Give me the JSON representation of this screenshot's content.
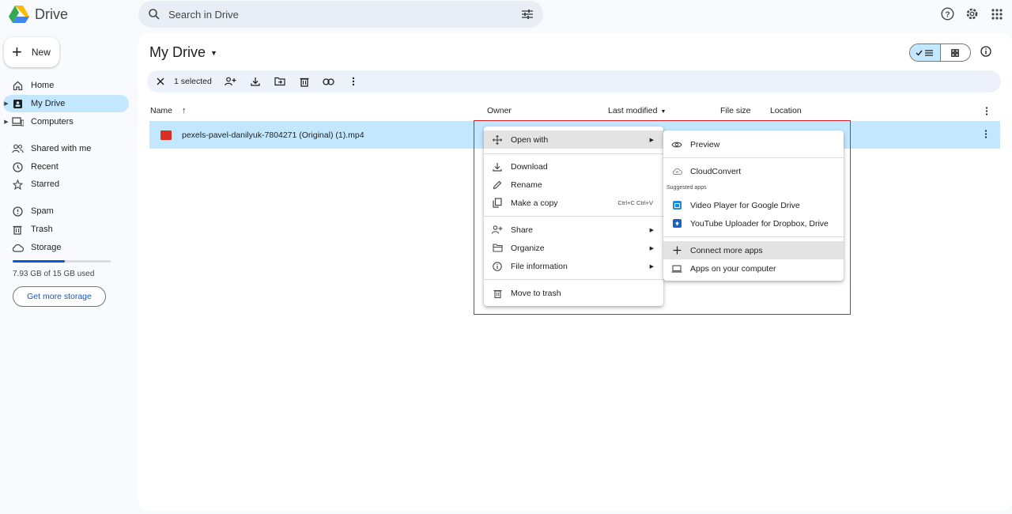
{
  "app": {
    "name": "Drive"
  },
  "search": {
    "placeholder": "Search in Drive"
  },
  "new_button": {
    "label": "New"
  },
  "sidebar": {
    "items": [
      {
        "label": "Home",
        "icon": "home-icon"
      },
      {
        "label": "My Drive",
        "icon": "my-drive-icon",
        "active": true
      },
      {
        "label": "Computers",
        "icon": "computers-icon"
      },
      {
        "label": "Shared with me",
        "icon": "shared-icon"
      },
      {
        "label": "Recent",
        "icon": "clock-icon"
      },
      {
        "label": "Starred",
        "icon": "star-icon"
      },
      {
        "label": "Spam",
        "icon": "spam-icon"
      },
      {
        "label": "Trash",
        "icon": "trash-icon"
      },
      {
        "label": "Storage",
        "icon": "cloud-icon"
      }
    ],
    "storage_used_fraction": 0.529,
    "storage_text": "7.93 GB of 15 GB used",
    "get_storage_label": "Get more storage"
  },
  "main": {
    "title": "My Drive",
    "selection": {
      "label": "1 selected"
    },
    "columns": {
      "name": "Name",
      "owner": "Owner",
      "last_modified": "Last modified",
      "file_size": "File size",
      "location": "Location"
    },
    "files": [
      {
        "name": "pexels-pavel-danilyuk-7804271 (Original) (1).mp4",
        "type": "video"
      }
    ]
  },
  "context_menu": {
    "open_with": "Open with",
    "download": "Download",
    "rename": "Rename",
    "make_copy": "Make a copy",
    "make_copy_shortcut": "Ctrl+C Ctrl+V",
    "share": "Share",
    "organize": "Organize",
    "file_information": "File information",
    "move_to_trash": "Move to trash"
  },
  "submenu": {
    "preview": "Preview",
    "cloudconvert": "CloudConvert",
    "suggested_header": "Suggested apps",
    "video_player": "Video Player for Google Drive",
    "youtube_uploader": "YouTube Uploader for Dropbox, Drive",
    "connect_more": "Connect more apps",
    "apps_on_computer": "Apps on your computer"
  },
  "colors": {
    "accent": "#0b57d0",
    "selected_row": "#c2e7ff",
    "highlight_box": "#e02020"
  }
}
